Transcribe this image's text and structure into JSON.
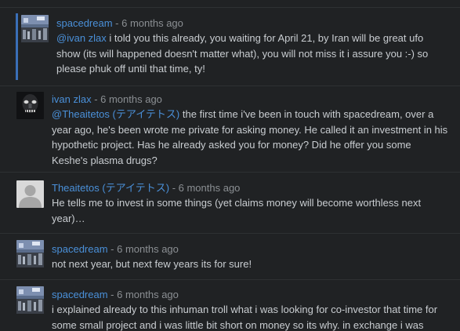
{
  "comments": [
    {
      "author": "spacedream",
      "separator": " - ",
      "time": "6 months ago",
      "mention": "@ivan zlax",
      "mention_prefix": "@",
      "mention_name": "ivan zlax",
      "text": " i told you this already, you waiting for April 21, by Iran will be great ufo show (its will happened doesn't matter what), you will not miss it i assure you :-) so please phuk off until that time, ty!"
    },
    {
      "author": "ivan zlax",
      "separator": " - ",
      "time": "6 months ago",
      "mention_prefix": "@",
      "mention_name": "Theaitetos (テアイテトス)",
      "text": " the first time i've been in touch with spacedream, over a year ago, he's been wrote me private for asking money. He called it an investment in his hypothetic project. Has he already asked you for money? Did he offer you some Keshe's plasma drugs?"
    },
    {
      "author": "Theaitetos (テアイテトス)",
      "separator": " - ",
      "time": "6 months ago",
      "text": "He tells me to invest in some things (yet claims money will become worthless next year)…"
    },
    {
      "author": "spacedream",
      "separator": " - ",
      "time": "6 months ago",
      "text": "not next year, but next few years its for sure!"
    },
    {
      "author": "spacedream",
      "separator": " - ",
      "time": "6 months ago",
      "text": "i explained already to this inhuman troll what i was looking for co-investor that time for some small project and i was little bit short on money so its why. in exchange i was"
    }
  ]
}
